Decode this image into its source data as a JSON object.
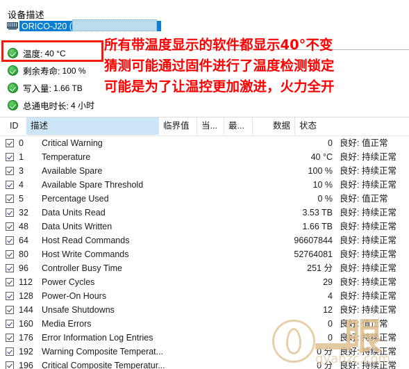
{
  "panel": {
    "title": "设备描述",
    "device_name": "ORICO-J20 (",
    "device_redacted": "",
    "stats": [
      {
        "icon": "green-check-icon",
        "label": "温度:",
        "value": "40 °C",
        "highlighted": true
      },
      {
        "icon": "green-check-icon",
        "label": "剩余寿命:",
        "value": "100 %",
        "highlighted": false
      },
      {
        "icon": "green-check-icon",
        "label": "写入量:",
        "value": "1.66 TB",
        "highlighted": false
      },
      {
        "icon": "green-check-icon",
        "label": "总通电时长:",
        "value": "4 小时",
        "highlighted": false
      }
    ]
  },
  "annotation": {
    "color": "#fe0000",
    "lines": [
      "所有带温度显示的软件都显示40°不变",
      "猜测可能通过固件进行了温度检测锁定",
      "可能是为了让温控更加激进，火力全开"
    ]
  },
  "highlight_box": {
    "color": "#f41b0c"
  },
  "table": {
    "columns": [
      {
        "key": "id",
        "label": "ID"
      },
      {
        "key": "desc",
        "label": "描述",
        "sorted": true
      },
      {
        "key": "thr",
        "label": "临界值"
      },
      {
        "key": "cur",
        "label": "当..."
      },
      {
        "key": "wst",
        "label": "最..."
      },
      {
        "key": "data",
        "label": "数据"
      },
      {
        "key": "status",
        "label": "状态"
      }
    ],
    "rows": [
      {
        "checked": true,
        "id": "0",
        "desc": "Critical Warning",
        "thr": "",
        "cur": "",
        "wst": "",
        "data": "0",
        "status": "良好: 值正常"
      },
      {
        "checked": true,
        "id": "1",
        "desc": "Temperature",
        "thr": "",
        "cur": "",
        "wst": "",
        "data": "40 °C",
        "status": "良好: 持续正常"
      },
      {
        "checked": true,
        "id": "3",
        "desc": "Available Spare",
        "thr": "",
        "cur": "",
        "wst": "",
        "data": "100 %",
        "status": "良好: 持续正常"
      },
      {
        "checked": true,
        "id": "4",
        "desc": "Available Spare Threshold",
        "thr": "",
        "cur": "",
        "wst": "",
        "data": "10 %",
        "status": "良好: 持续正常"
      },
      {
        "checked": true,
        "id": "5",
        "desc": "Percentage Used",
        "thr": "",
        "cur": "",
        "wst": "",
        "data": "0 %",
        "status": "良好: 值正常"
      },
      {
        "checked": true,
        "id": "32",
        "desc": "Data Units Read",
        "thr": "",
        "cur": "",
        "wst": "",
        "data": "3.53 TB",
        "status": "良好: 持续正常"
      },
      {
        "checked": true,
        "id": "48",
        "desc": "Data Units Written",
        "thr": "",
        "cur": "",
        "wst": "",
        "data": "1.66 TB",
        "status": "良好: 持续正常"
      },
      {
        "checked": true,
        "id": "64",
        "desc": "Host Read Commands",
        "thr": "",
        "cur": "",
        "wst": "",
        "data": "96607844",
        "status": "良好: 持续正常"
      },
      {
        "checked": true,
        "id": "80",
        "desc": "Host Write Commands",
        "thr": "",
        "cur": "",
        "wst": "",
        "data": "52764081",
        "status": "良好: 持续正常"
      },
      {
        "checked": true,
        "id": "96",
        "desc": "Controller Busy Time",
        "thr": "",
        "cur": "",
        "wst": "",
        "data": "251 分",
        "status": "良好: 持续正常"
      },
      {
        "checked": true,
        "id": "112",
        "desc": "Power Cycles",
        "thr": "",
        "cur": "",
        "wst": "",
        "data": "29",
        "status": "良好: 持续正常"
      },
      {
        "checked": true,
        "id": "128",
        "desc": "Power-On Hours",
        "thr": "",
        "cur": "",
        "wst": "",
        "data": "4",
        "status": "良好: 持续正常"
      },
      {
        "checked": true,
        "id": "144",
        "desc": "Unsafe Shutdowns",
        "thr": "",
        "cur": "",
        "wst": "",
        "data": "12",
        "status": "良好: 持续正常"
      },
      {
        "checked": true,
        "id": "160",
        "desc": "Media Errors",
        "thr": "",
        "cur": "",
        "wst": "",
        "data": "0",
        "status": "良好: 值正常"
      },
      {
        "checked": true,
        "id": "176",
        "desc": "Error Information Log Entries",
        "thr": "",
        "cur": "",
        "wst": "",
        "data": "0",
        "status": "良好: 持续正常"
      },
      {
        "checked": true,
        "id": "192",
        "desc": "Warning Composite Temperat...",
        "thr": "",
        "cur": "",
        "wst": "",
        "data": "0 分",
        "status": "良好: 持续正常"
      },
      {
        "checked": true,
        "id": "196",
        "desc": "Critical Composite Temperatur...",
        "thr": "",
        "cur": "",
        "wst": "",
        "data": "0 分",
        "status": "良好: 持续正常"
      }
    ]
  },
  "watermark": {
    "character": "眼",
    "domain": "gyanzc.com"
  }
}
